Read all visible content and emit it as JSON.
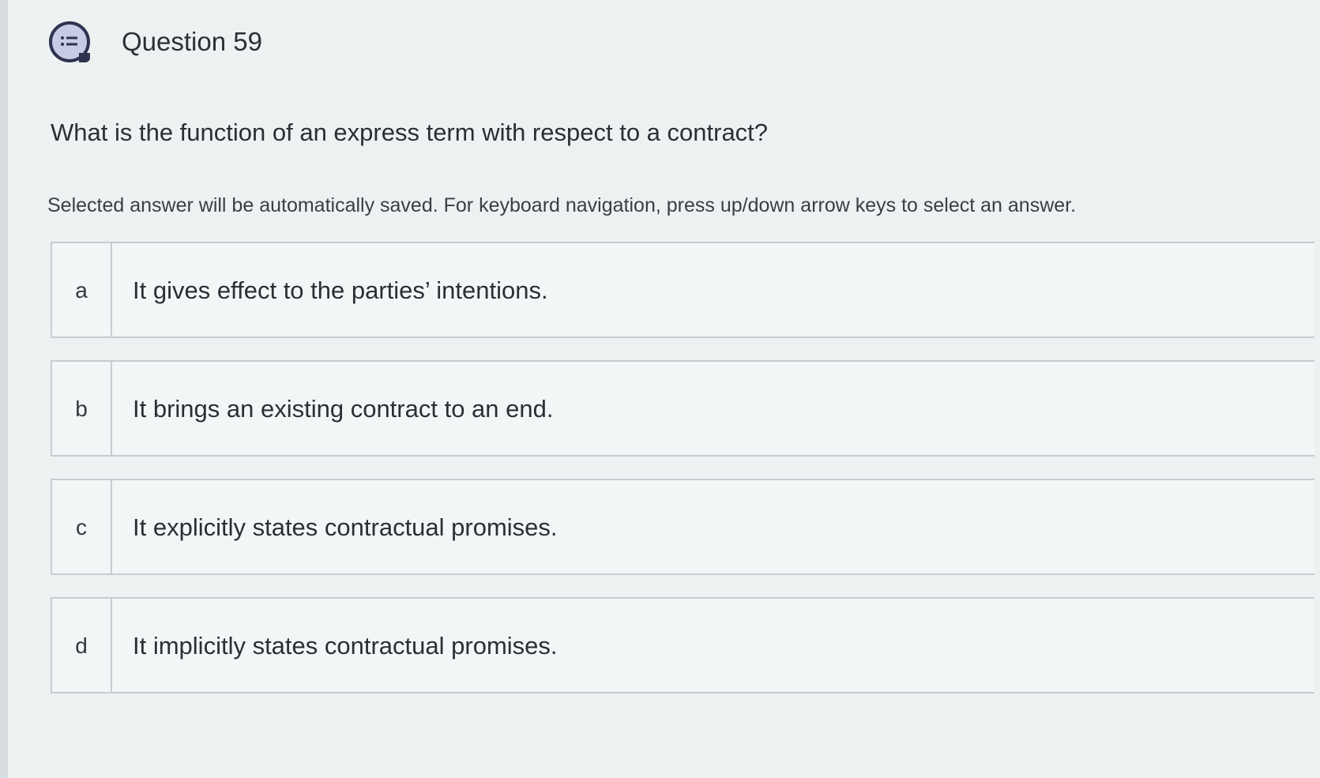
{
  "header": {
    "icon": "question-list-icon",
    "title": "Question 59"
  },
  "question": {
    "text": "What is the function of an express term with respect to a contract?",
    "instructions": "Selected answer will be automatically saved. For keyboard navigation, press up/down arrow keys to select an answer."
  },
  "options": [
    {
      "letter": "a",
      "text": "It gives effect to the parties’ intentions."
    },
    {
      "letter": "b",
      "text": "It brings an existing contract to an end."
    },
    {
      "letter": "c",
      "text": "It explicitly states contractual promises."
    },
    {
      "letter": "d",
      "text": "It implicitly states contractual promises."
    }
  ]
}
